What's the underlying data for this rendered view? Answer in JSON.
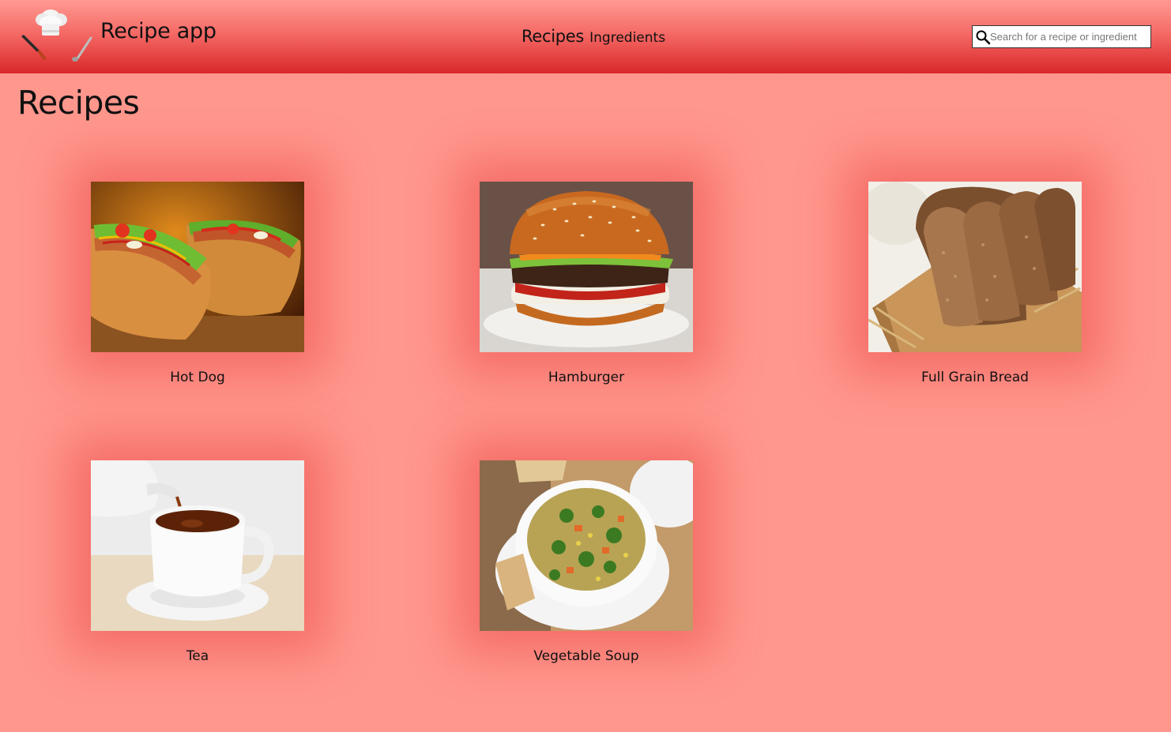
{
  "header": {
    "app_title": "Recipe app",
    "nav": {
      "recipes_label": "Recipes",
      "ingredients_label": "Ingredients"
    },
    "search": {
      "placeholder": "Search for a recipe or ingredient",
      "value": ""
    }
  },
  "main": {
    "page_title": "Recipes",
    "recipes": [
      {
        "name": "Hot Dog",
        "image_icon": "hot-dog-photo"
      },
      {
        "name": "Hamburger",
        "image_icon": "hamburger-photo"
      },
      {
        "name": "Full Grain Bread",
        "image_icon": "bread-photo"
      },
      {
        "name": "Tea",
        "image_icon": "tea-photo"
      },
      {
        "name": "Vegetable Soup",
        "image_icon": "vegetable-soup-photo"
      }
    ]
  },
  "colors": {
    "page_background": "#ff978d",
    "header_gradient_top": "#ff9a92",
    "header_gradient_bottom": "#d9282a",
    "card_glow": "#e83434"
  }
}
